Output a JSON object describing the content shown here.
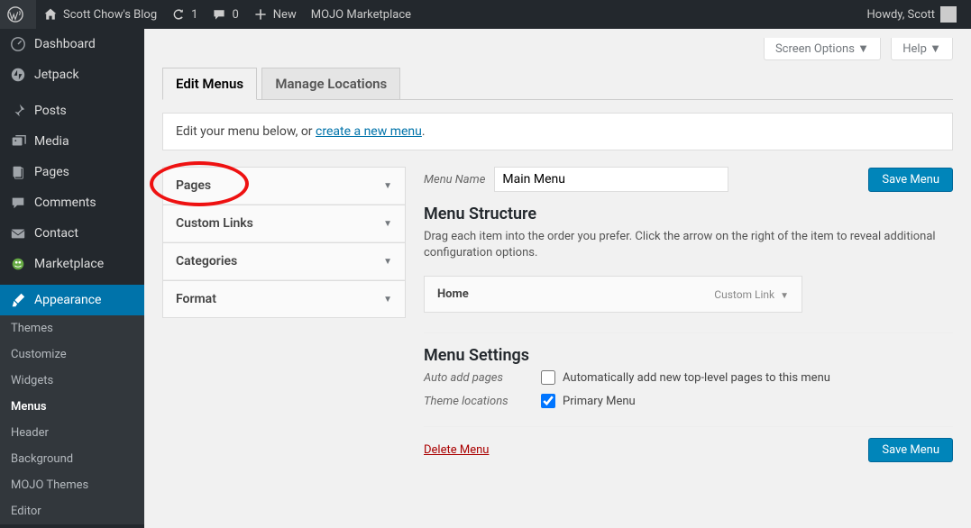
{
  "adminbar": {
    "site_name": "Scott Chow's Blog",
    "refresh_count": "1",
    "comment_count": "0",
    "new_label": "New",
    "mojo_label": "MOJO Marketplace",
    "howdy": "Howdy, Scott"
  },
  "sidebar": {
    "items": [
      {
        "label": "Dashboard"
      },
      {
        "label": "Jetpack"
      },
      {
        "label": "Posts"
      },
      {
        "label": "Media"
      },
      {
        "label": "Pages"
      },
      {
        "label": "Comments"
      },
      {
        "label": "Contact"
      },
      {
        "label": "Marketplace"
      },
      {
        "label": "Appearance"
      }
    ],
    "sub": [
      "Themes",
      "Customize",
      "Widgets",
      "Menus",
      "Header",
      "Background",
      "MOJO Themes",
      "Editor"
    ]
  },
  "screen": {
    "options": "Screen Options",
    "help": "Help"
  },
  "tabs": {
    "edit": "Edit Menus",
    "manage": "Manage Locations"
  },
  "info": {
    "prefix": "Edit your menu below, or ",
    "link": "create a new menu",
    "suffix": "."
  },
  "accordion": [
    "Pages",
    "Custom Links",
    "Categories",
    "Format"
  ],
  "menu": {
    "name_label": "Menu Name",
    "name_value": "Main Menu",
    "save": "Save Menu",
    "structure_h": "Menu Structure",
    "structure_p": "Drag each item into the order you prefer. Click the arrow on the right of the item to reveal additional configuration options.",
    "item": {
      "title": "Home",
      "type": "Custom Link"
    },
    "settings_h": "Menu Settings",
    "auto_label": "Auto add pages",
    "auto_text": "Automatically add new top-level pages to this menu",
    "theme_label": "Theme locations",
    "theme_text": "Primary Menu",
    "delete": "Delete Menu"
  }
}
